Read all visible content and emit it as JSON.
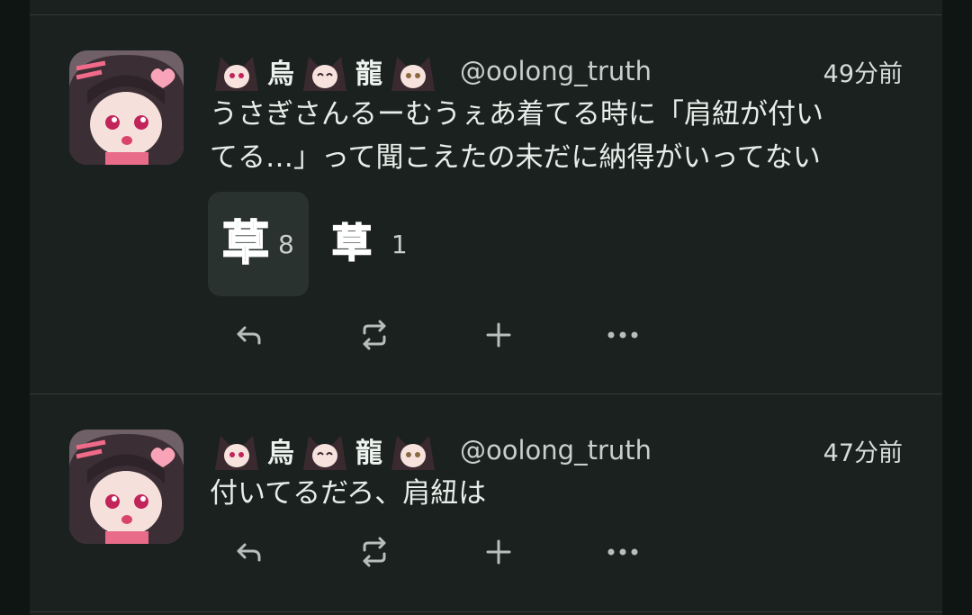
{
  "notes": [
    {
      "user": {
        "name_chars": [
          "烏",
          "龍"
        ],
        "handle": "@oolong_truth"
      },
      "time": "49分前",
      "text": "うさぎさんるーむうぇあ着てる時に「肩紐が付い\nてる…」って聞こえたの未だに納得がいってない",
      "reactions": [
        {
          "emoji": "草",
          "count": "8",
          "active": true,
          "color": "#22c03a"
        },
        {
          "emoji": "草",
          "count": "1",
          "active": false,
          "color": "#1e8a55"
        }
      ]
    },
    {
      "user": {
        "name_chars": [
          "烏",
          "龍"
        ],
        "handle": "@oolong_truth"
      },
      "time": "47分前",
      "text": "付いてるだろ、肩紐は",
      "reactions": []
    }
  ],
  "actions": [
    "reply-icon",
    "renote-icon",
    "plus-icon",
    "more-icon"
  ],
  "colors": {
    "background": "#1b211f",
    "accent_green": "#22c03a"
  }
}
